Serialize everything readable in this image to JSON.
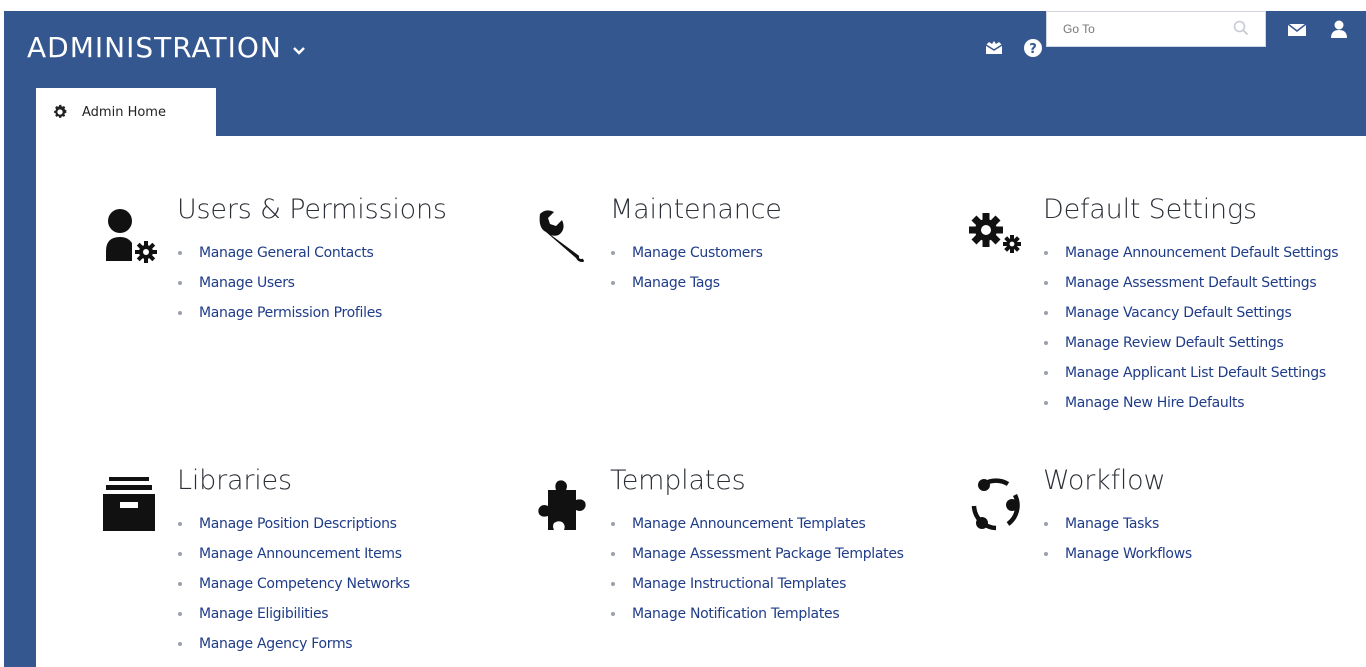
{
  "header": {
    "title": "ADMINISTRATION",
    "search_placeholder": "Go To"
  },
  "tab": {
    "label": "Admin Home"
  },
  "sections": [
    {
      "title": "Users & Permissions",
      "icon": "user-gear-icon",
      "links": [
        "Manage General Contacts",
        "Manage Users",
        "Manage Permission Profiles"
      ]
    },
    {
      "title": "Maintenance",
      "icon": "wrench-icon",
      "links": [
        "Manage Customers",
        "Manage Tags"
      ]
    },
    {
      "title": "Default Settings",
      "icon": "gears-icon",
      "links": [
        "Manage Announcement Default Settings",
        "Manage Assessment Default Settings",
        "Manage Vacancy Default Settings",
        "Manage Review Default Settings",
        "Manage Applicant List Default Settings",
        "Manage New Hire Defaults"
      ]
    },
    {
      "title": "Libraries",
      "icon": "archive-icon",
      "links": [
        "Manage Position Descriptions",
        "Manage Announcement Items",
        "Manage Competency Networks",
        "Manage Eligibilities",
        "Manage Agency Forms"
      ]
    },
    {
      "title": "Templates",
      "icon": "puzzle-icon",
      "links": [
        "Manage Announcement Templates",
        "Manage Assessment Package Templates",
        "Manage Instructional Templates",
        "Manage Notification Templates"
      ]
    },
    {
      "title": "Workflow",
      "icon": "workflow-cycle-icon",
      "links": [
        "Manage Tasks",
        "Manage Workflows"
      ]
    }
  ],
  "colors": {
    "header_bg": "#35578f",
    "link": "#1f3c88",
    "heading": "#2b2f36"
  }
}
